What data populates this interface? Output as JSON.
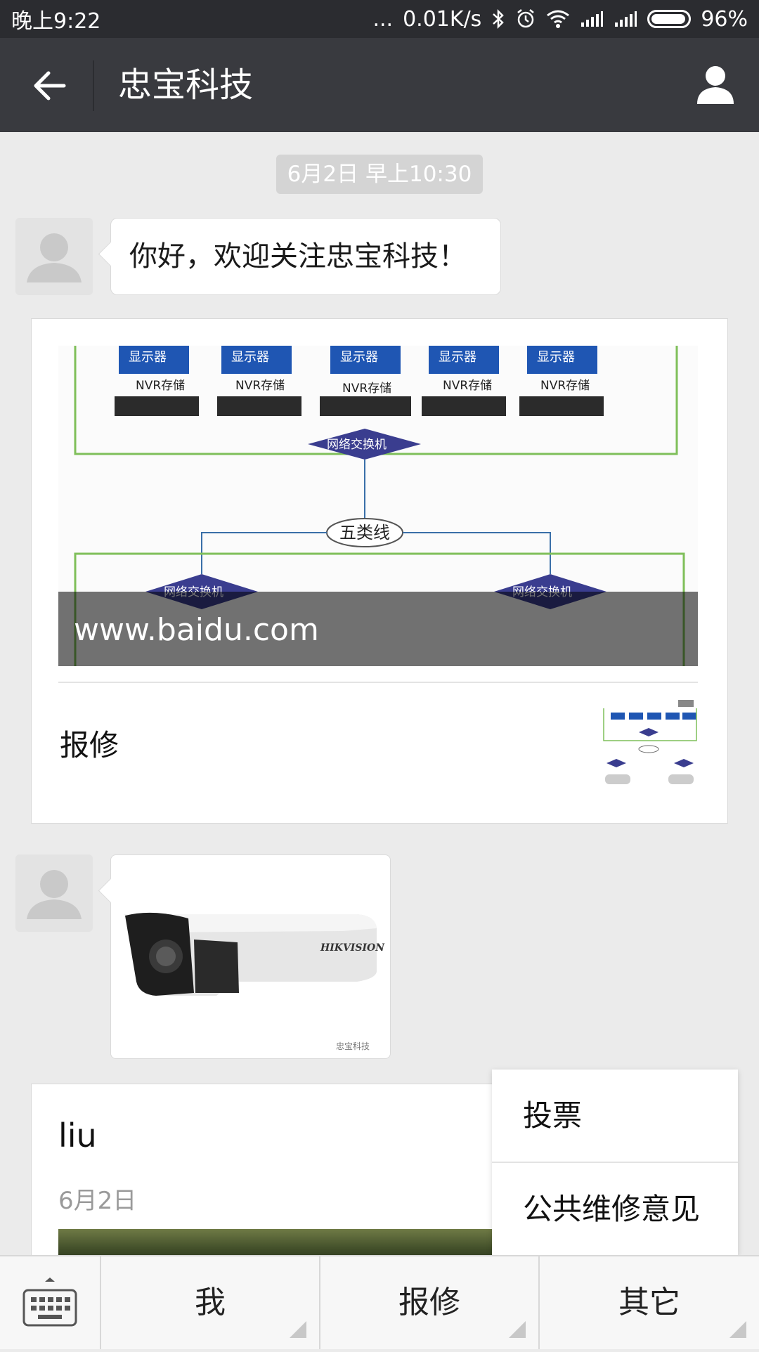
{
  "status_bar": {
    "time": "晚上9:22",
    "dots": "...",
    "speed": "0.01K/s",
    "battery": "96%",
    "icons": [
      "bluetooth-icon",
      "alarm-icon",
      "wifi-icon",
      "signal-icon",
      "signal-icon",
      "battery-icon"
    ]
  },
  "header": {
    "title": "忠宝科技",
    "back_icon": "back-arrow-icon",
    "profile_icon": "person-icon"
  },
  "chat": {
    "timestamp": "6月2日 早上10:30",
    "messages": [
      {
        "type": "text",
        "text": "你好，欢迎关注忠宝科技！"
      },
      {
        "type": "news_card",
        "image_caption": "www.baidu.com",
        "title": "报修",
        "diagram_labels": {
          "monitor": "显示器",
          "nvr": "NVR存储",
          "switch": "网络交换机",
          "cable": "五类线"
        }
      },
      {
        "type": "image",
        "brand": "HIKVISION",
        "watermark": "忠宝科技"
      },
      {
        "type": "article",
        "title": "liu",
        "date": "6月2日"
      }
    ]
  },
  "popup_menu": {
    "items": [
      "投票",
      "公共维修意见"
    ]
  },
  "bottom_menu": {
    "keyboard_icon": "keyboard-icon",
    "items": [
      "我",
      "报修",
      "其它"
    ]
  }
}
